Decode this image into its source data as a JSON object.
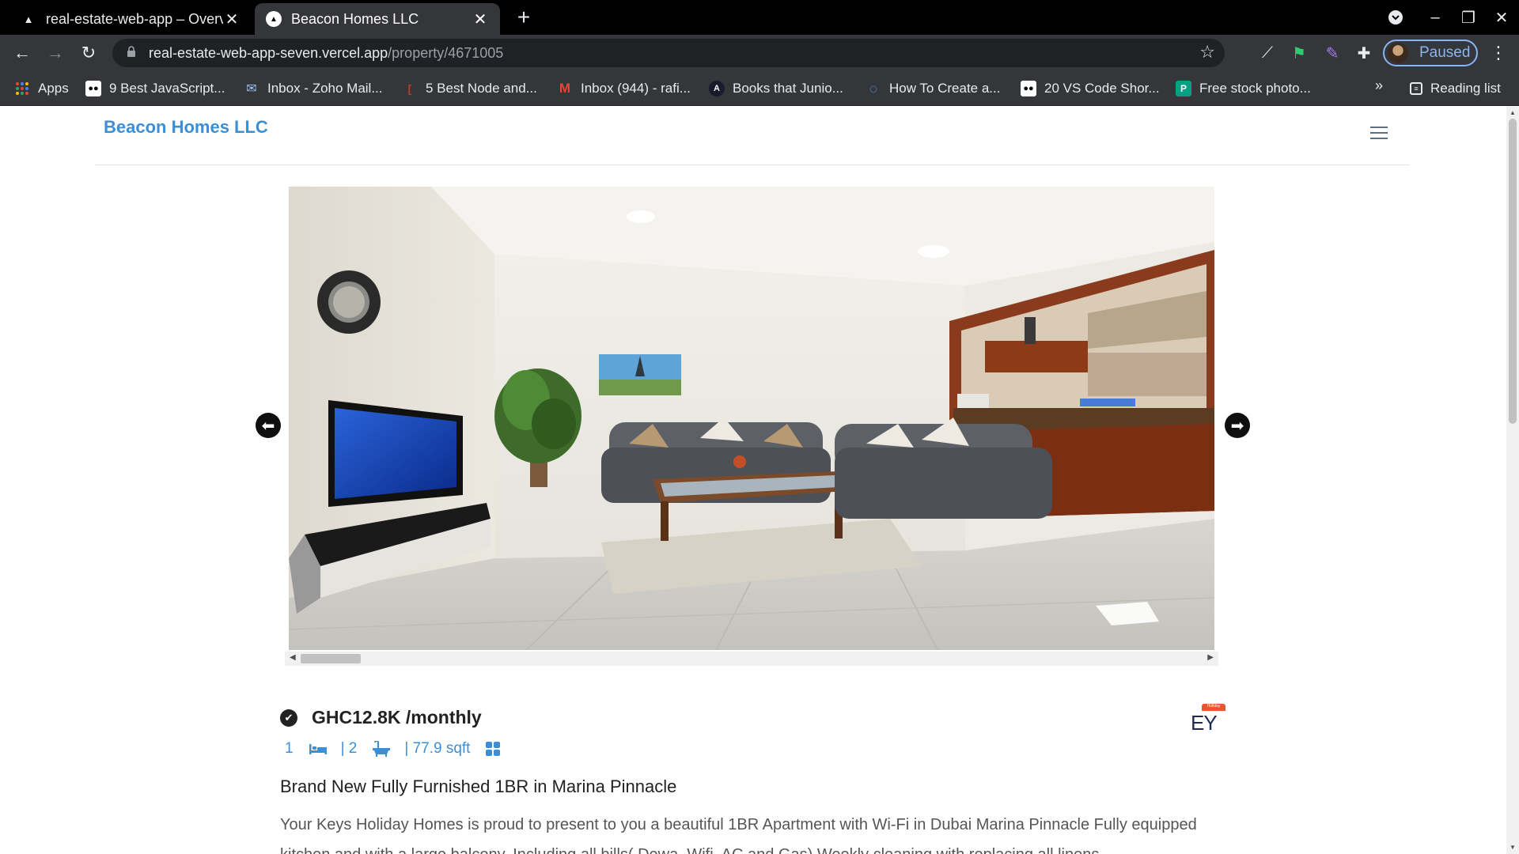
{
  "browser": {
    "tabs": [
      {
        "title": "real-estate-web-app – Overview",
        "favicon": "vercel-triangle-icon",
        "active": false
      },
      {
        "title": "Beacon Homes LLC",
        "favicon": "vercel-triangle-icon",
        "active": true
      }
    ],
    "new_tab": "+",
    "window_controls": {
      "minimize": "–",
      "restore": "❐",
      "close": "✕"
    },
    "url": {
      "host": "real-estate-web-app-seven.vercel.app",
      "path": "/property/4671005"
    },
    "profile_status": "Paused",
    "bookmarks": [
      {
        "label": "Apps",
        "icon": "apps-grid-icon"
      },
      {
        "label": "9 Best JavaScript...",
        "icon": "medium-icon"
      },
      {
        "label": "Inbox - Zoho Mail...",
        "icon": "zoho-mail-icon"
      },
      {
        "label": "5 Best Node and...",
        "icon": "bracket-icon"
      },
      {
        "label": "Inbox (944) - rafi...",
        "icon": "gmail-icon"
      },
      {
        "label": "Books that Junio...",
        "icon": "a-badge-icon"
      },
      {
        "label": "How To Create a...",
        "icon": "blue-c-icon"
      },
      {
        "label": "20 VS Code Shor...",
        "icon": "medium-icon"
      },
      {
        "label": "Free stock photo...",
        "icon": "pexels-icon"
      }
    ],
    "bookmarks_overflow": "»",
    "reading_list": "Reading list",
    "colors": {
      "chrome_dark": "#35363a",
      "tab_bar": "#000000",
      "accent": "#8ab4f8"
    }
  },
  "site": {
    "brand": "Beacon Homes LLC",
    "brand_color": "#3b8fd6"
  },
  "property": {
    "price": "GHC12.8K /monthly",
    "rooms": "1",
    "baths": "| 2",
    "area": "| 77.9 sqft",
    "title": "Brand New Fully Furnished 1BR in Marina Pinnacle",
    "description": "Your Keys Holiday Homes is proud to present to you a beautiful 1BR Apartment with Wi-Fi in Dubai Marina Pinnacle Fully equipped kitchen and with a large balcony. Including all bills( Dewa, Wifi, AC and Gas) Weekly cleaning with replacing all linens",
    "agency_logo_text": "EY",
    "agency_logo_tag": "Holiday"
  }
}
